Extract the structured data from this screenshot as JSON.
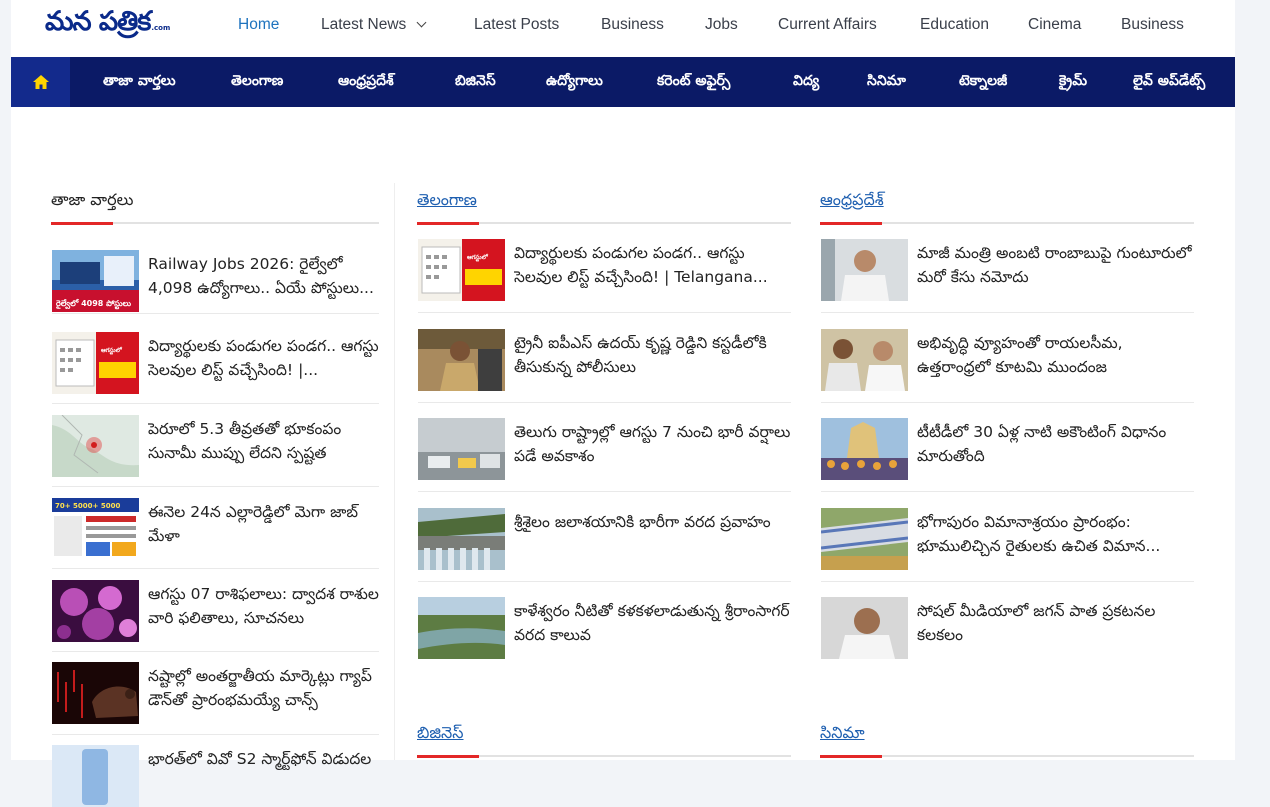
{
  "site": {
    "logo_text": "మన పత్రిక",
    "logo_suffix": ".com"
  },
  "main_nav": [
    {
      "label": "Home",
      "active": true
    },
    {
      "label": "Latest News",
      "dropdown": true
    },
    {
      "label": "Latest Posts"
    },
    {
      "label": "Business"
    },
    {
      "label": "Jobs"
    },
    {
      "label": "Current Affairs"
    },
    {
      "label": "Education"
    },
    {
      "label": "Cinema"
    },
    {
      "label": "Business"
    }
  ],
  "category_nav": {
    "home_icon": "home-icon",
    "items": [
      "తాజా వార్తలు",
      "తెలంగాణ",
      "ఆంధ్రప్రదేశ్",
      "బిజినెస్",
      "ఉద్యోగాలు",
      "కరెంట్ అఫైర్స్",
      "విద్య",
      "సినిమా",
      "టెక్నాలజీ",
      "క్రైమ్",
      "లైవ్ అప్‌డేట్స్"
    ]
  },
  "columns": [
    {
      "title": "తాజా వార్తలు",
      "title_link": false,
      "items": [
        {
          "headline": "Railway Jobs 2026: రైల్వేలో 4,098 ఉద్యోగాలు.. ఏయే పోస్టులు...",
          "thumb": "railway-jobs-thumbnail",
          "thumb_text": "రైల్వేలో 4098 పోస్టులు"
        },
        {
          "headline": "విద్యార్థులకు పండుగల పండగ.. ఆగస్టు సెలవుల లిస్ట్ వచ్చేసింది! |...",
          "thumb": "holidays-calendar-thumbnail",
          "thumb_text": "ఆగస్టులో బడులకు 10 సెలవులు"
        },
        {
          "headline": "పెరూలో 5.3 తీవ్రతతో భూకంపం సునామీ ముప్పు లేదని స్పష్టత",
          "thumb": "earthquake-map-thumbnail"
        },
        {
          "headline": "ఈనెల 24న ఎల్లారెడ్డిలో మెగా జాబ్ మేళా",
          "thumb": "job-mela-poster-thumbnail",
          "thumb_text": "70+ 5000+ 5000"
        },
        {
          "headline": "ఆగస్టు 07 రాశిఫలాలు: ద్వాదశ రాశుల వారి ఫలితాలు, సూచనలు",
          "thumb": "zodiac-orbs-thumbnail"
        },
        {
          "headline": "నష్టాల్లో అంతర్జాతీయ మార్కెట్లు గ్యాప్ డౌన్‌తో ప్రారంభమయ్యే చాన్స్",
          "thumb": "bear-market-thumbnail"
        },
        {
          "headline": "భారత్‌లో వివో S2 స్మార్ట్‌ఫోన్ విడుదల",
          "thumb": "smartphone-thumbnail"
        }
      ]
    },
    {
      "title": "తెలంగాణ",
      "title_link": true,
      "items": [
        {
          "headline": "విద్యార్థులకు పండుగల పండగ.. ఆగస్టు సెలవుల లిస్ట్ వచ్చేసింది! | Telangana...",
          "thumb": "holidays-calendar-thumbnail",
          "thumb_text": "ఆగస్టులో బడులకు 10 సెలవులు"
        },
        {
          "headline": "ట్రైనీ ఐపీఎస్ ఉదయ్ కృష్ణ రెడ్డిని కస్టడీలోకి తీసుకున్న పోలీసులు",
          "thumb": "police-officer-thumbnail"
        },
        {
          "headline": "తెలుగు రాష్ట్రాల్లో ఆగస్టు 7 నుంచి భారీ వర్షాలు పడే అవకాశం",
          "thumb": "rain-traffic-thumbnail"
        },
        {
          "headline": "శ్రీశైలం జలాశయానికి భారీగా వరద ప్రవాహం",
          "thumb": "dam-thumbnail"
        },
        {
          "headline": "కాళేశ్వరం నీటితో కళకళలాడుతున్న శ్రీరాంసాగర్ వరద కాలువ",
          "thumb": "canal-thumbnail"
        }
      ]
    },
    {
      "title": "ఆంధ్రప్రదేశ్",
      "title_link": true,
      "items": [
        {
          "headline": "మాజీ మంత్రి అంబటి రాంబాబుపై గుంటూరులో మరో కేసు నమోదు",
          "thumb": "politician-thumbnail"
        },
        {
          "headline": "అభివృద్ధి వ్యూహంతో రాయలసీమ, ఉత్తరాంధ్రలో కూటమి ముందంజ",
          "thumb": "leaders-meeting-thumbnail"
        },
        {
          "headline": "టీటీడీలో 30 ఏళ్ల నాటి అకౌంటింగ్ విధానం మారుతోంది",
          "thumb": "temple-thumbnail"
        },
        {
          "headline": "భోగాపురం విమానాశ్రయం ప్రారంభం: భూములిచ్చిన రైతులకు ఉచిత విమాన...",
          "thumb": "airport-thumbnail"
        },
        {
          "headline": "సోషల్ మీడియాలో జగన్ పాత ప్రకటనల కలకలం",
          "thumb": "leader-portrait-thumbnail"
        }
      ]
    }
  ],
  "lower_sections": [
    "బిజినెస్",
    "సినిమా"
  ]
}
